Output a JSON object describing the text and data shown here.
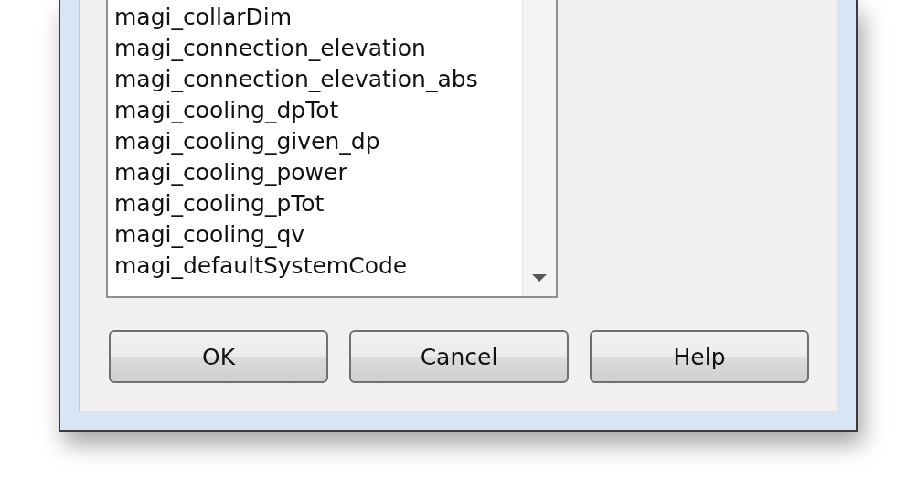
{
  "list": {
    "items": [
      {
        "label": "magi_collarDim"
      },
      {
        "label": "magi_connection_elevation"
      },
      {
        "label": "magi_connection_elevation_abs"
      },
      {
        "label": "magi_cooling_dpTot"
      },
      {
        "label": "magi_cooling_given_dp"
      },
      {
        "label": "magi_cooling_power"
      },
      {
        "label": "magi_cooling_pTot"
      },
      {
        "label": "magi_cooling_qv"
      },
      {
        "label": "magi_defaultSystemCode"
      }
    ]
  },
  "buttons": [
    {
      "label": "OK"
    },
    {
      "label": "Cancel"
    },
    {
      "label": "Help"
    }
  ]
}
